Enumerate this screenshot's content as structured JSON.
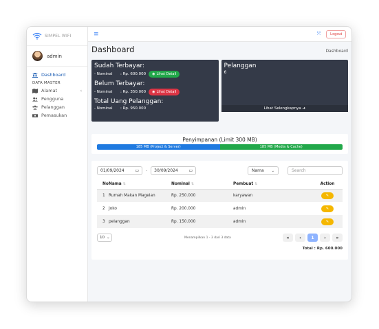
{
  "brand": {
    "name": "SIMPEL WIFI"
  },
  "user": {
    "name": "admin"
  },
  "sidebar": {
    "dashboard": "Dashboard",
    "section_header": "DATA MASTER",
    "items": [
      {
        "label": "Alamat",
        "icon": "map-icon",
        "chevron": "‹"
      },
      {
        "label": "Pengguna",
        "icon": "users-icon"
      },
      {
        "label": "Pelanggan",
        "icon": "users-group-icon"
      },
      {
        "label": "Pemasukan",
        "icon": "money-icon"
      }
    ]
  },
  "topbar": {
    "logout": "Logout"
  },
  "page": {
    "title": "Dashboard",
    "breadcrumb": "Dashboard"
  },
  "summary": {
    "paid_title": "Sudah Terbayar:",
    "paid_label": "- Nominal",
    "paid_value": ": Rp. 600.000",
    "paid_button": "Lihat Detail",
    "unpaid_title": "Belum Terbayar:",
    "unpaid_label": "- Nominal",
    "unpaid_value": ": Rp. 350.000",
    "unpaid_button": "Lihat Detail",
    "total_title": "Total Uang Pelanggan:",
    "total_label": "- Nominal",
    "total_value": ": Rp. 950.000"
  },
  "customers": {
    "title": "Pelanggan",
    "count": "6",
    "more": "Lihat Selengkapnya"
  },
  "storage": {
    "title": "Penyimpanan (Limit 300 MB)",
    "project_label": "185 MB (Project & Server)",
    "media_label": "185 MB (Media & Cache)",
    "colors": {
      "project": "#1f7ae0",
      "media": "#22a84a"
    }
  },
  "filters": {
    "date_from": "01/09/2024",
    "separator": "-",
    "date_to": "30/09/2024",
    "sort_select": "Nama",
    "search_placeholder": "Search"
  },
  "table": {
    "headers": {
      "no": "No",
      "nama": "Nama",
      "nominal": "Nominal",
      "pembuat": "Pembuat",
      "action": "Action"
    },
    "rows": [
      {
        "no": "1",
        "nama": "Rumah Makan Magelan",
        "nominal": "Rp. 250.000",
        "pembuat": "karyawan"
      },
      {
        "no": "2",
        "nama": "Joko",
        "nominal": "Rp. 200.000",
        "pembuat": "admin"
      },
      {
        "no": "3",
        "nama": "pelanggan",
        "nominal": "Rp. 150.000",
        "pembuat": "admin"
      }
    ]
  },
  "pagination": {
    "per_page": "10",
    "info": "Menampilkan 1 - 3 dari 3 data",
    "first": "«",
    "prev": "‹",
    "current": "1",
    "next": "›",
    "last": "»"
  },
  "total": "Total : Rp. 600.000"
}
